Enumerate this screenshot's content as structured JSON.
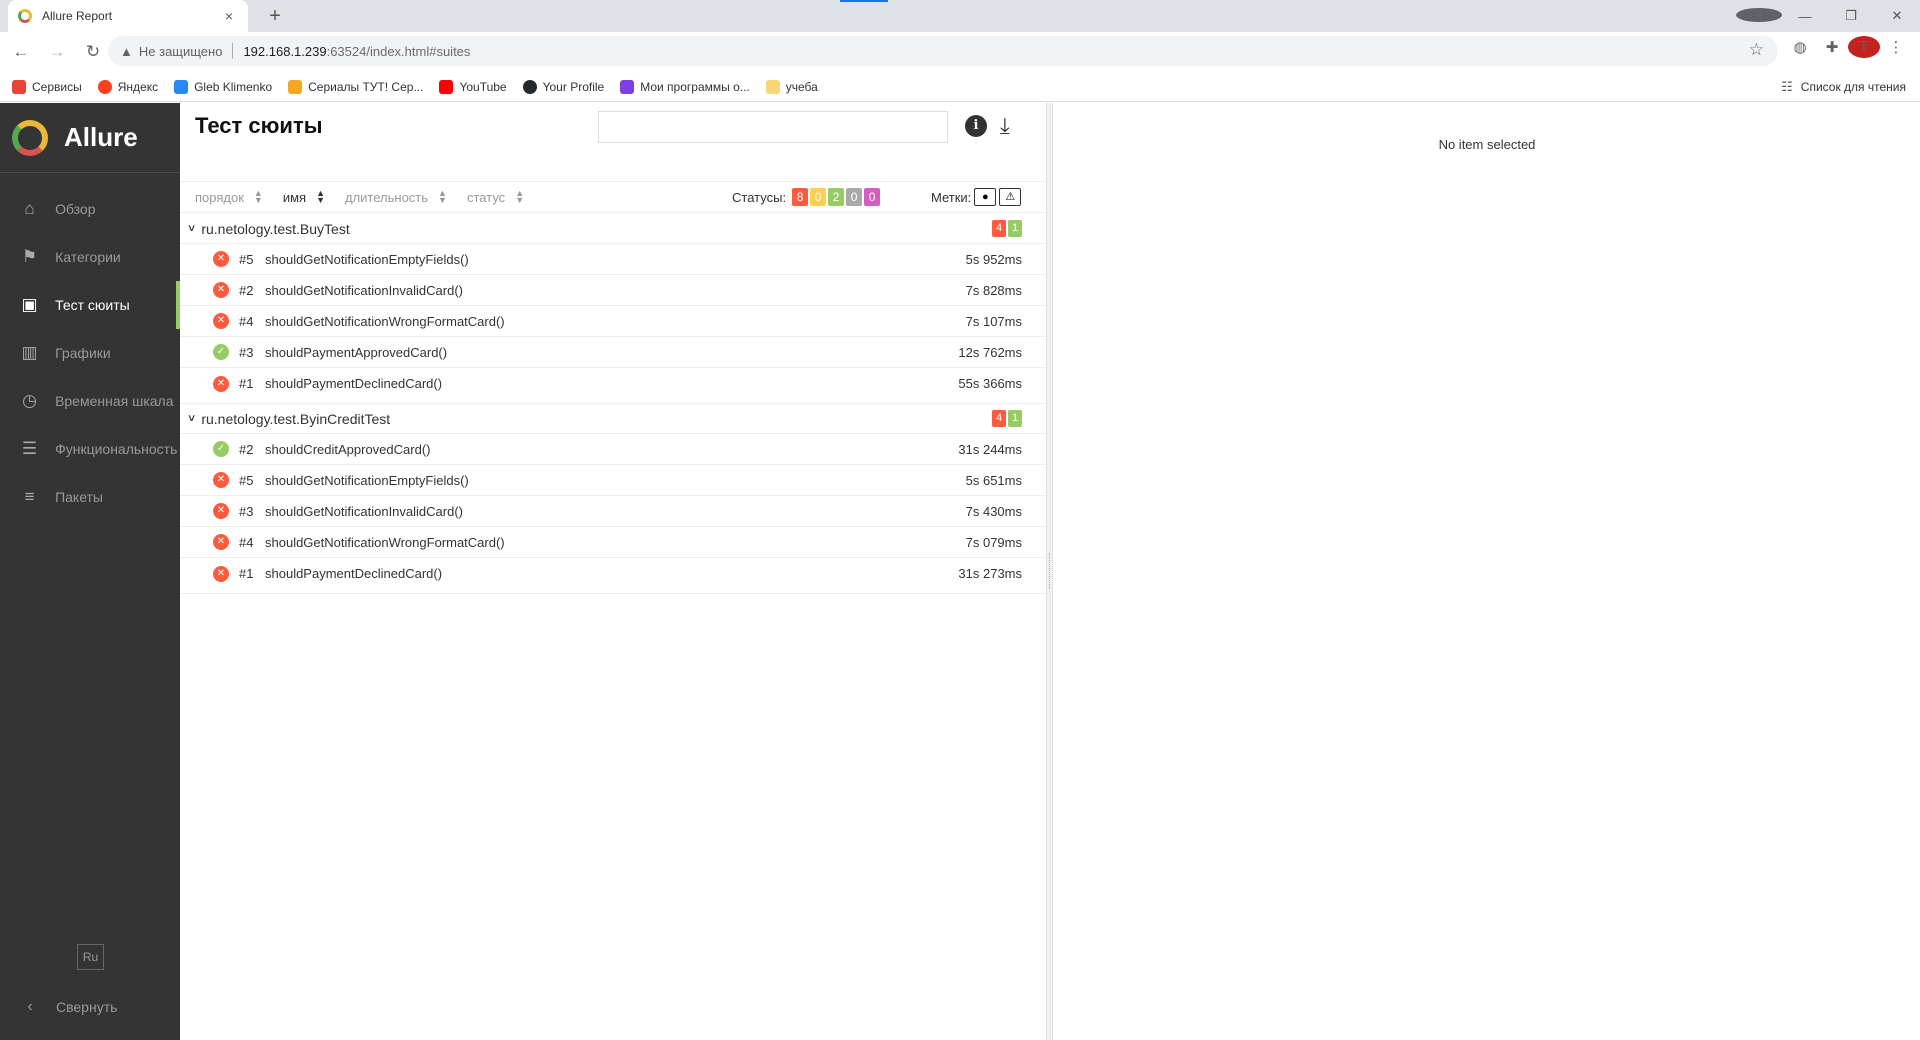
{
  "browser": {
    "tab_title": "Allure Report",
    "tab_close": "×",
    "new_tab": "+",
    "security_text": "Не защищено",
    "url_host": "192.168.1.239",
    "url_rest": ":63524/index.html#suites",
    "avatar_letter": "T",
    "bookmarks": [
      {
        "label": "Сервисы",
        "color": "#ea4335"
      },
      {
        "label": "Яндекс",
        "color": "#fc3f1d"
      },
      {
        "label": "Gleb Klimenko",
        "color": "#2787f5"
      },
      {
        "label": "Сериалы ТУТ! Сер...",
        "color": "#f5a623"
      },
      {
        "label": "YouTube",
        "color": "#ff0000"
      },
      {
        "label": "Your Profile",
        "color": "#24292e"
      },
      {
        "label": "Мои программы о...",
        "color": "#7b3fe4"
      },
      {
        "label": "учеба",
        "color": "#f7d774"
      }
    ],
    "reading_list": "Список для чтения"
  },
  "sidebar": {
    "brand": "Allure",
    "items": [
      {
        "label": "Обзор",
        "icon": "home-icon",
        "glyph": "⌂",
        "active": false
      },
      {
        "label": "Категории",
        "icon": "flag-icon",
        "glyph": "⚑",
        "active": false
      },
      {
        "label": "Тест сюиты",
        "icon": "briefcase-icon",
        "glyph": "▣",
        "active": true
      },
      {
        "label": "Графики",
        "icon": "bar-chart-icon",
        "glyph": "▥",
        "active": false
      },
      {
        "label": "Временная шкала",
        "icon": "clock-icon",
        "glyph": "◷",
        "active": false
      },
      {
        "label": "Функциональность",
        "icon": "list-icon",
        "glyph": "☰",
        "active": false
      },
      {
        "label": "Пакеты",
        "icon": "align-left-icon",
        "glyph": "≡",
        "active": false
      }
    ],
    "lang": "Ru",
    "collapse": "Свернуть"
  },
  "main": {
    "title": "Тест сюиты",
    "search_placeholder": "",
    "sort": {
      "order": "порядок",
      "name": "имя",
      "duration": "длительность",
      "status": "статус"
    },
    "statuses_label": "Статусы:",
    "status_counts": [
      {
        "value": "8",
        "color": "#fd5a3e"
      },
      {
        "value": "0",
        "color": "#ffd050"
      },
      {
        "value": "2",
        "color": "#97cc64"
      },
      {
        "value": "0",
        "color": "#aaaaaa"
      },
      {
        "value": "0",
        "color": "#d35ebe"
      }
    ],
    "marks_label": "Метки:",
    "groups": [
      {
        "name": "ru.netology.test.BuyTest",
        "failed": "4",
        "passed": "1",
        "tests": [
          {
            "num": "#5",
            "name": "shouldGetNotificationEmptyFields()",
            "duration": "5s 952ms",
            "status": "failed"
          },
          {
            "num": "#2",
            "name": "shouldGetNotificationInvalidCard()",
            "duration": "7s 828ms",
            "status": "failed"
          },
          {
            "num": "#4",
            "name": "shouldGetNotificationWrongFormatCard()",
            "duration": "7s 107ms",
            "status": "failed"
          },
          {
            "num": "#3",
            "name": "shouldPaymentApprovedCard()",
            "duration": "12s 762ms",
            "status": "passed"
          },
          {
            "num": "#1",
            "name": "shouldPaymentDeclinedCard()",
            "duration": "55s 366ms",
            "status": "failed"
          }
        ]
      },
      {
        "name": "ru.netology.test.ByinCreditTest",
        "failed": "4",
        "passed": "1",
        "tests": [
          {
            "num": "#2",
            "name": "shouldCreditApprovedCard()",
            "duration": "31s 244ms",
            "status": "passed"
          },
          {
            "num": "#5",
            "name": "shouldGetNotificationEmptyFields()",
            "duration": "5s 651ms",
            "status": "failed"
          },
          {
            "num": "#3",
            "name": "shouldGetNotificationInvalidCard()",
            "duration": "7s 430ms",
            "status": "failed"
          },
          {
            "num": "#4",
            "name": "shouldGetNotificationWrongFormatCard()",
            "duration": "7s 079ms",
            "status": "failed"
          },
          {
            "num": "#1",
            "name": "shouldPaymentDeclinedCard()",
            "duration": "31s 273ms",
            "status": "failed"
          }
        ]
      }
    ]
  },
  "detail": {
    "empty_text": "No item selected"
  }
}
